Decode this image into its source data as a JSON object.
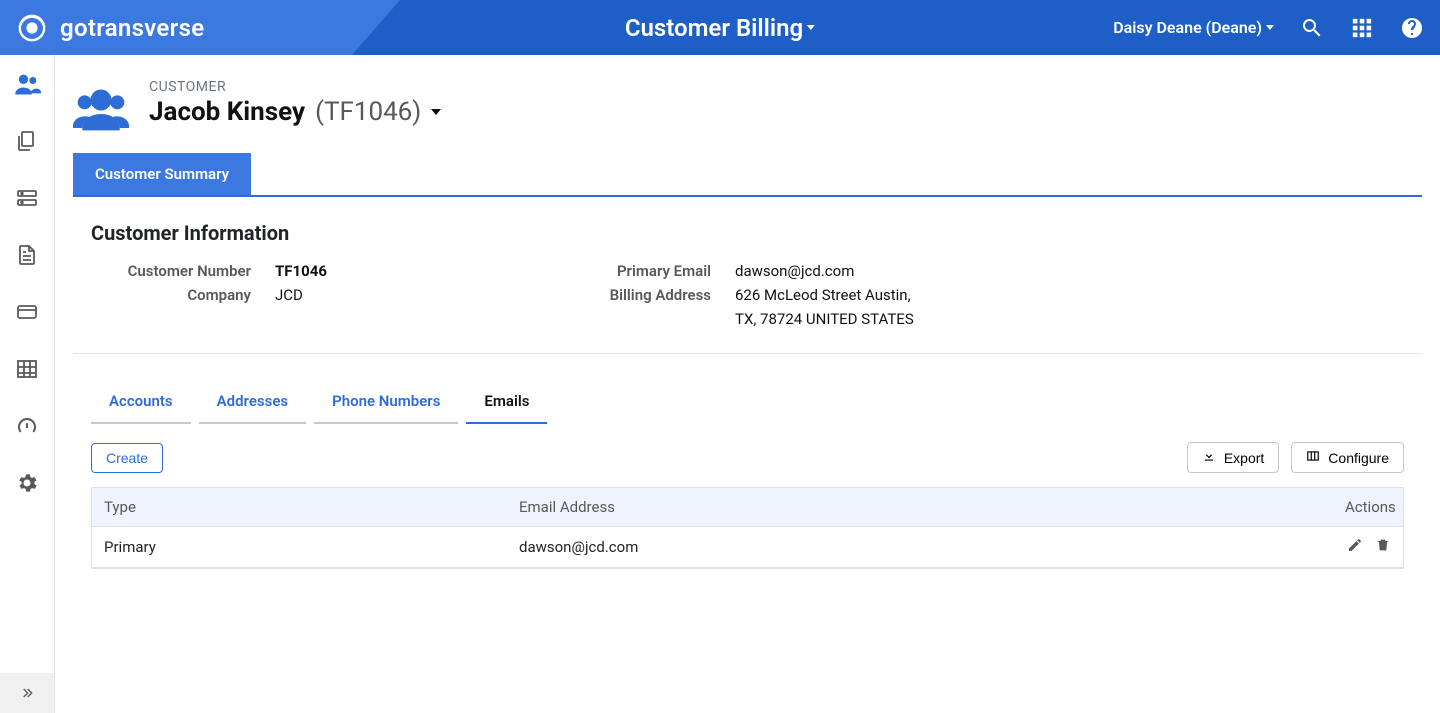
{
  "header": {
    "brand": "gotransverse",
    "title": "Customer Billing",
    "user": "Daisy Deane (Deane)"
  },
  "customer": {
    "eyebrow": "CUSTOMER",
    "name": "Jacob Kinsey",
    "id": "(TF1046)"
  },
  "top_tabs": {
    "summary": "Customer Summary"
  },
  "info": {
    "section_title": "Customer Information",
    "labels": {
      "customer_number": "Customer Number",
      "company": "Company",
      "primary_email": "Primary Email",
      "billing_address": "Billing Address"
    },
    "values": {
      "customer_number": "TF1046",
      "company": "JCD",
      "primary_email": "dawson@jcd.com",
      "billing_address_l1": "626 McLeod Street Austin,",
      "billing_address_l2": "TX, 78724 UNITED STATES"
    }
  },
  "sub_tabs": {
    "accounts": "Accounts",
    "addresses": "Addresses",
    "phone": "Phone Numbers",
    "emails": "Emails"
  },
  "buttons": {
    "create": "Create",
    "export": "Export",
    "configure": "Configure"
  },
  "table": {
    "headers": {
      "type": "Type",
      "email": "Email Address",
      "actions": "Actions"
    },
    "rows": [
      {
        "type": "Primary",
        "email": "dawson@jcd.com"
      }
    ]
  }
}
